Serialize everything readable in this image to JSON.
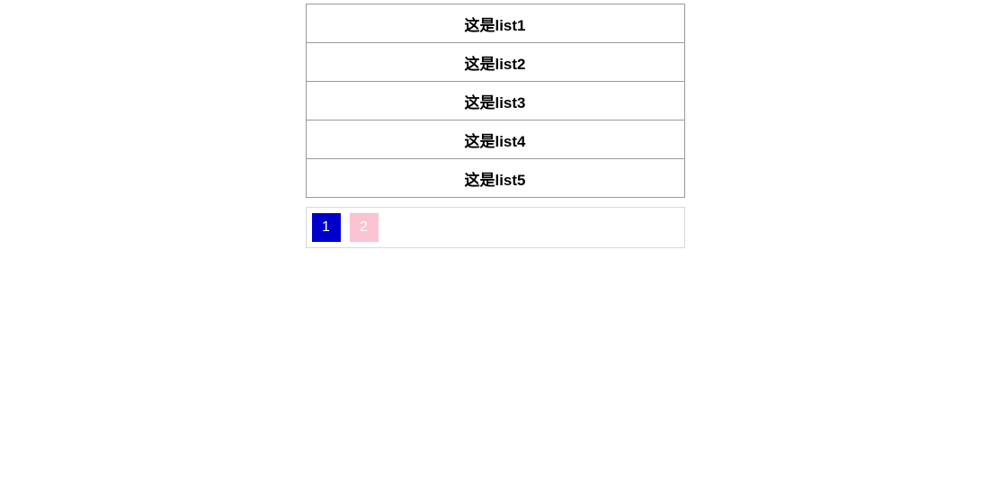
{
  "list": {
    "items": [
      {
        "label": "这是list1"
      },
      {
        "label": "这是list2"
      },
      {
        "label": "这是list3"
      },
      {
        "label": "这是list4"
      },
      {
        "label": "这是list5"
      }
    ]
  },
  "pagination": {
    "pages": [
      {
        "label": "1",
        "active": true
      },
      {
        "label": "2",
        "active": false
      }
    ]
  },
  "colors": {
    "active_page": "#0000cc",
    "inactive_page": "#fbc3d1"
  }
}
